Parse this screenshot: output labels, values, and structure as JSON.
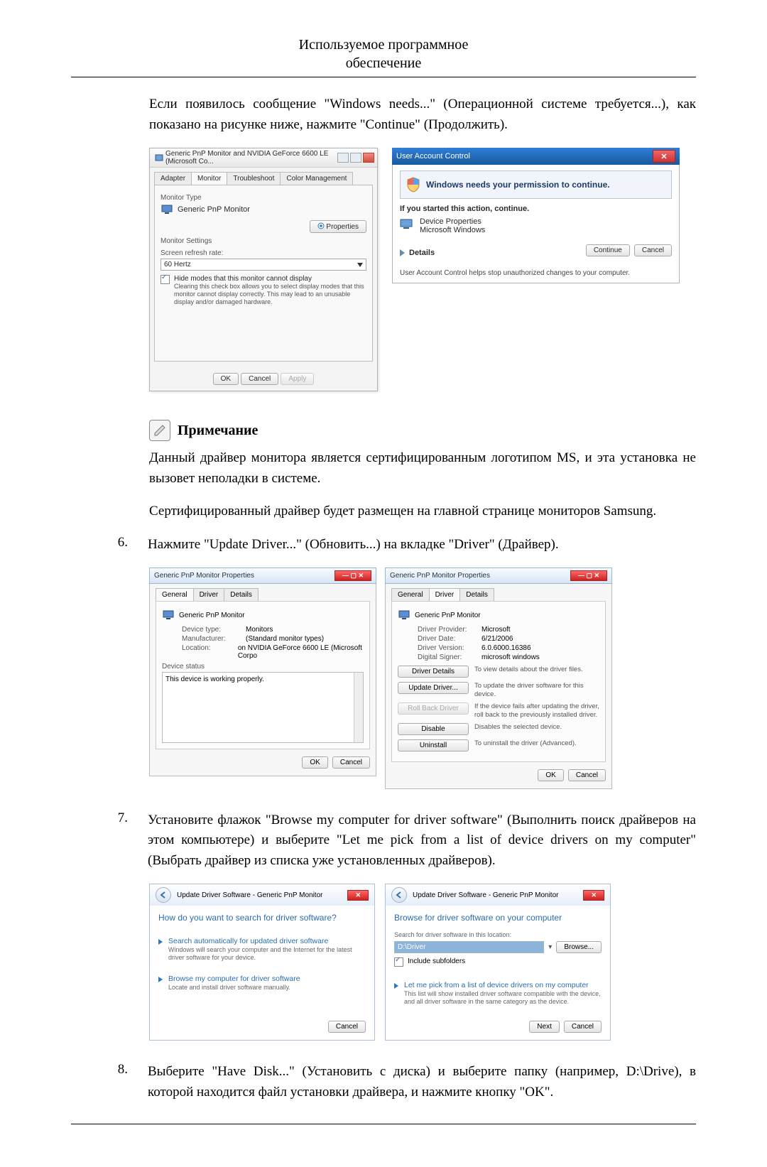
{
  "header": {
    "line1": "Используемое программное",
    "line2": "обеспечение"
  },
  "intro": "Если появилось сообщение \"Windows needs...\" (Операционной системе требуется...), как показано на рисунке ниже, нажмите \"Continue\" (Продолжить).",
  "fig1": {
    "dlgA": {
      "title": "Generic PnP Monitor and NVIDIA GeForce 6600 LE (Microsoft Co...",
      "tabs": [
        "Adapter",
        "Monitor",
        "Troubleshoot",
        "Color Management"
      ],
      "monitorType": "Monitor Type",
      "monitorName": "Generic PnP Monitor",
      "properties": "Properties",
      "monitorSettings": "Monitor Settings",
      "refreshLabel": "Screen refresh rate:",
      "refreshValue": "60 Hertz",
      "hideModes": "Hide modes that this monitor cannot display",
      "hideModesDesc": "Clearing this check box allows you to select display modes that this monitor cannot display correctly. This may lead to an unusable display and/or damaged hardware.",
      "ok": "OK",
      "cancel": "Cancel",
      "apply": "Apply"
    },
    "uac": {
      "title": "User Account Control",
      "banner": "Windows needs your permission to continue.",
      "sub": "If you started this action, continue.",
      "deviceProps": "Device Properties",
      "publisher": "Microsoft Windows",
      "details": "Details",
      "continue": "Continue",
      "cancel": "Cancel",
      "foot": "User Account Control helps stop unauthorized changes to your computer."
    }
  },
  "note": {
    "title": "Примечание",
    "p1": "Данный драйвер монитора является сертифицированным логотипом MS, и эта установка не вызовет неполадки в системе.",
    "p2": "Сертифицированный драйвер будет размещен на главной странице мониторов Samsung."
  },
  "step6": {
    "num": "6.",
    "text": "Нажмите \"Update Driver...\" (Обновить...) на вкладке \"Driver\" (Драйвер)."
  },
  "fig2": {
    "title": "Generic PnP Monitor Properties",
    "tabs": [
      "General",
      "Driver",
      "Details"
    ],
    "left": {
      "monitorName": "Generic PnP Monitor",
      "deviceType": {
        "k": "Device type:",
        "v": "Monitors"
      },
      "manufacturer": {
        "k": "Manufacturer:",
        "v": "(Standard monitor types)"
      },
      "location": {
        "k": "Location:",
        "v": "on NVIDIA GeForce 6600 LE (Microsoft Corpo"
      },
      "deviceStatusLabel": "Device status",
      "deviceStatusText": "This device is working properly.",
      "ok": "OK",
      "cancel": "Cancel"
    },
    "right": {
      "monitorName": "Generic PnP Monitor",
      "provider": {
        "k": "Driver Provider:",
        "v": "Microsoft"
      },
      "date": {
        "k": "Driver Date:",
        "v": "6/21/2006"
      },
      "version": {
        "k": "Driver Version:",
        "v": "6.0.6000.16386"
      },
      "signer": {
        "k": "Digital Signer:",
        "v": "microsoft windows"
      },
      "driverDetails": {
        "btn": "Driver Details",
        "desc": "To view details about the driver files."
      },
      "updateDriver": {
        "btn": "Update Driver...",
        "desc": "To update the driver software for this device."
      },
      "rollBack": {
        "btn": "Roll Back Driver",
        "desc": "If the device fails after updating the driver, roll back to the previously installed driver."
      },
      "disable": {
        "btn": "Disable",
        "desc": "Disables the selected device."
      },
      "uninstall": {
        "btn": "Uninstall",
        "desc": "To uninstall the driver (Advanced)."
      },
      "ok": "OK",
      "cancel": "Cancel"
    }
  },
  "step7": {
    "num": "7.",
    "text": "Установите флажок \"Browse my computer for driver software\" (Выполнить поиск драйверов на этом компьютере) и выберите \"Let me pick from a list of device drivers on my computer\" (Выбрать драйвер из списка уже установленных драйверов)."
  },
  "fig3": {
    "crumb": "Update Driver Software - Generic PnP Monitor",
    "wizA": {
      "heading": "How do you want to search for driver software?",
      "opt1": {
        "title": "Search automatically for updated driver software",
        "desc": "Windows will search your computer and the Internet for the latest driver software for your device."
      },
      "opt2": {
        "title": "Browse my computer for driver software",
        "desc": "Locate and install driver software manually."
      },
      "cancel": "Cancel"
    },
    "wizB": {
      "heading": "Browse for driver software on your computer",
      "searchLoc": "Search for driver software in this location:",
      "path": "D:\\Driver",
      "browse": "Browse...",
      "includeSub": "Include subfolders",
      "opt": {
        "title": "Let me pick from a list of device drivers on my computer",
        "desc": "This list will show installed driver software compatible with the device, and all driver software in the same category as the device."
      },
      "next": "Next",
      "cancel": "Cancel"
    }
  },
  "step8": {
    "num": "8.",
    "text": "Выберите \"Have Disk...\" (Установить с диска) и выберите папку (например, D:\\Drive), в которой находится файл установки драйвера, и нажмите кнопку \"OK\"."
  }
}
